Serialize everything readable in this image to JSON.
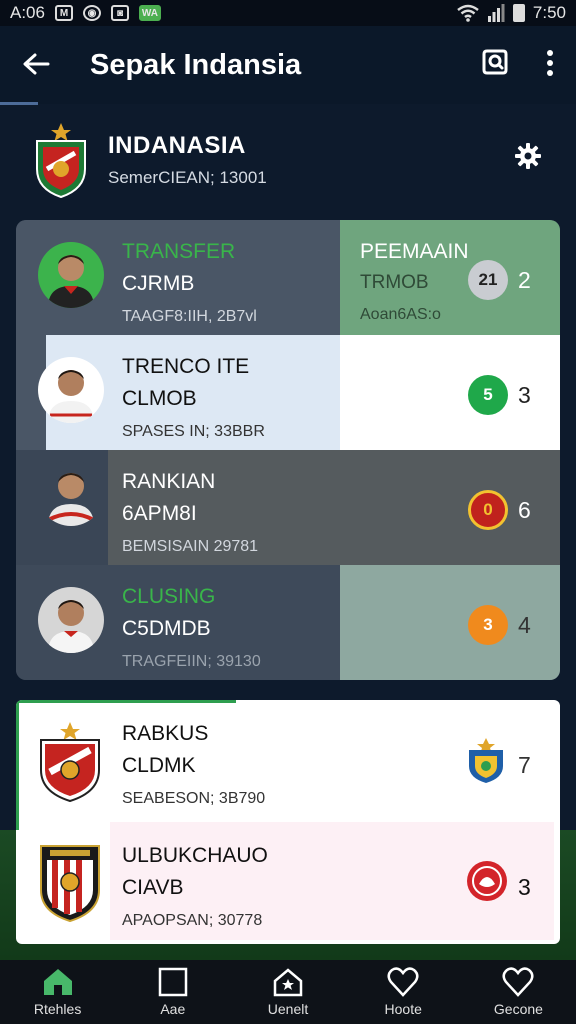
{
  "status_bar": {
    "time_left": "A:06",
    "time_right": "7:50",
    "icon_m": "M",
    "icon_wa": "WA"
  },
  "app_bar": {
    "title": "Sepak Indansia"
  },
  "team": {
    "name": "INDANASIA",
    "subtitle": "SemerCIEAN; 13001"
  },
  "ranking_rows": [
    {
      "line1": "TRANSFER",
      "line2": "CJRMB",
      "line3": "TAAGF8:IIH, 2B7vl",
      "right_line1": "PEEMAAIN",
      "right_line2": "TRMOB",
      "right_line3": "Aoan6AS:o",
      "badge": "21",
      "number": "2",
      "badge_color": "#c9ccd1"
    },
    {
      "line1": "TRENCO ITE",
      "line2": "CLMOB",
      "line3": "SPASES IN; 33BBR",
      "badge": "5",
      "number": "3",
      "badge_color": "#1fa84a"
    },
    {
      "line1": "RANKIAN",
      "line2": "6APM8I",
      "line3": "BEMSISAIN 29781",
      "badge": "0",
      "number": "6",
      "badge_color": "#c0221d"
    },
    {
      "line1": "CLUSING",
      "line2": "C5DMDB",
      "line3": "TRAGFEIIN; 39130",
      "badge": "3",
      "number": "4",
      "badge_color": "#f08a1d"
    }
  ],
  "club_rows": [
    {
      "line1": "RABKUS",
      "line2": "CLDMK",
      "line3": "SEABESON; 3B790",
      "number": "7"
    },
    {
      "line1": "ULBUKCHAUO",
      "line2": "CIAVB",
      "line3": "APAOPSAN; 30778",
      "number": "3"
    }
  ],
  "bottom_nav": [
    {
      "label": "Rtehles",
      "icon": "home-icon"
    },
    {
      "label": "Aae",
      "icon": "square-icon"
    },
    {
      "label": "Uenelt",
      "icon": "house-icon"
    },
    {
      "label": "Hoote",
      "icon": "heart-icon"
    },
    {
      "label": "Gecone",
      "icon": "heart-icon"
    }
  ],
  "colors": {
    "green": "#2e9e4f",
    "dark_bg": "#0d1a2c",
    "card_grey": "#3a4656"
  }
}
